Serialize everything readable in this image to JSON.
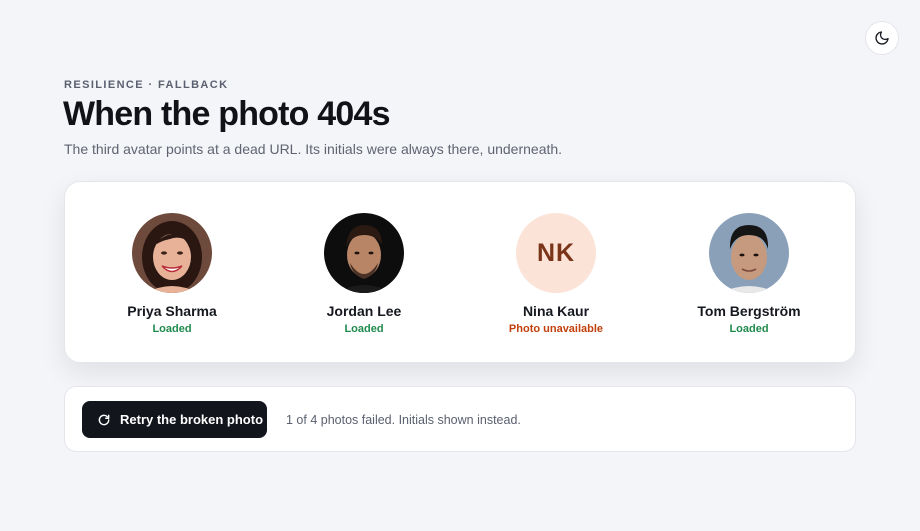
{
  "header": {
    "eyebrow": "RESILIENCE · FALLBACK",
    "title": "When the photo 404s",
    "subtitle": "The third avatar points at a dead URL. Its initials were always there, underneath."
  },
  "theme_toggle": {
    "icon": "moon-icon"
  },
  "people": [
    {
      "name": "Priya Sharma",
      "status": "Loaded",
      "state": "loaded"
    },
    {
      "name": "Jordan Lee",
      "status": "Loaded",
      "state": "loaded"
    },
    {
      "name": "Nina Kaur",
      "initials": "NK",
      "status": "Photo unavailable",
      "state": "failed"
    },
    {
      "name": "Tom Bergström",
      "status": "Loaded",
      "state": "loaded"
    }
  ],
  "actions": {
    "retry_label": "Retry the broken photo",
    "retry_icon": "refresh-icon",
    "summary": "1 of 4 photos failed. Initials shown instead."
  },
  "colors": {
    "status_loaded": "#1f8a4c",
    "status_failed": "#c2410c",
    "initials_bg": "#fbe3d8",
    "initials_text": "#7a3418",
    "button_bg": "#12151c"
  }
}
